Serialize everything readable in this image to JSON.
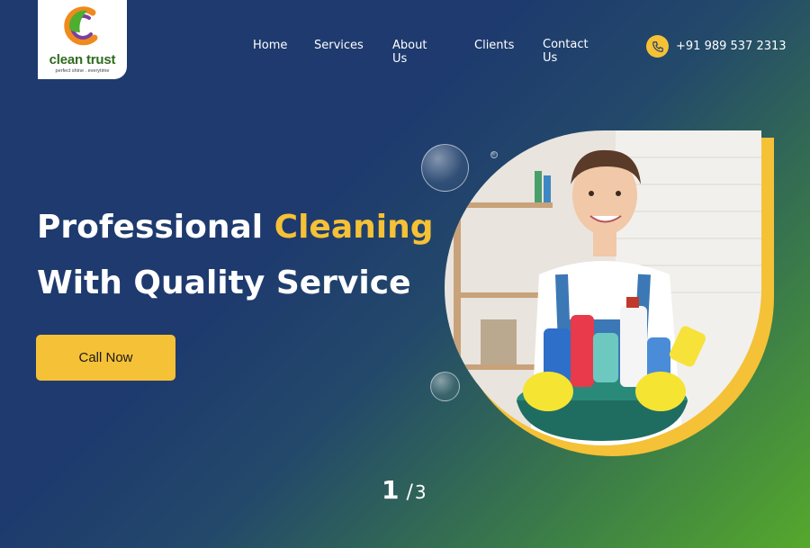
{
  "brand": {
    "name": "clean trust",
    "tagline": "perfect shine . everytime"
  },
  "nav": {
    "items": [
      {
        "label": "Home"
      },
      {
        "label": "Services"
      },
      {
        "label": "About Us"
      },
      {
        "label": "Clients"
      },
      {
        "label": "Contact Us"
      }
    ]
  },
  "contact": {
    "phone": "+91 989 537 2313",
    "icon": "phone-icon"
  },
  "hero": {
    "title_part1": "Professional ",
    "title_accent": "Cleaning",
    "title_line2": "With Quality Service",
    "cta_label": "Call Now"
  },
  "slider": {
    "current": "1",
    "separator": "/",
    "total": "3"
  },
  "colors": {
    "accent": "#f5c136",
    "navy": "#1e3a6e",
    "green": "#55a82c"
  }
}
